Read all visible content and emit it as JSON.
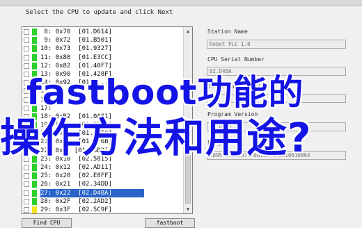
{
  "instruction": "Select the CPU to update and click Next",
  "cpu_list": [
    {
      "index": "8:",
      "addr": "0x70",
      "ver": "[01.D614]",
      "status": "green"
    },
    {
      "index": "9:",
      "addr": "0x72",
      "ver": "[01.B501]",
      "status": "green"
    },
    {
      "index": "10:",
      "addr": "0x73",
      "ver": "[01.9327]",
      "status": "green"
    },
    {
      "index": "11:",
      "addr": "0x80",
      "ver": "[01.E3CC]",
      "status": "green"
    },
    {
      "index": "12:",
      "addr": "0x82",
      "ver": "[01.40F7]",
      "status": "green"
    },
    {
      "index": "13:",
      "addr": "0x90",
      "ver": "[01.428F]",
      "status": "green"
    },
    {
      "index": "14:",
      "addr": "0x92",
      "ver": "[01.0...]",
      "status": "green"
    },
    {
      "index": "15:",
      "addr": "",
      "ver": "",
      "status": "green"
    },
    {
      "index": "16:",
      "addr": "",
      "ver": "",
      "status": "green"
    },
    {
      "index": "17:",
      "addr": "",
      "ver": "",
      "status": "green"
    },
    {
      "index": "18:",
      "addr": "0xB2",
      "ver": "[01.0A81]",
      "status": "green"
    },
    {
      "index": "19:",
      "addr": "0xC1",
      "ver": "[01.B51C]",
      "status": "green"
    },
    {
      "index": "20:",
      "addr": "0xC2",
      "ver": "[01.2A50]",
      "status": "green"
    },
    {
      "index": "21:",
      "addr": "0xD0",
      "ver": "[01.3F6B]",
      "status": "green"
    },
    {
      "index": "22:",
      "addr": "0x0",
      "ver": "[01.E8B3]",
      "status": "green"
    },
    {
      "index": "23:",
      "addr": "0x10",
      "ver": "[02.5815]",
      "status": "green"
    },
    {
      "index": "24:",
      "addr": "0x12",
      "ver": "[02.AD11]",
      "status": "green"
    },
    {
      "index": "25:",
      "addr": "0x20",
      "ver": "[02.E8FF]",
      "status": "green"
    },
    {
      "index": "26:",
      "addr": "0x21",
      "ver": "[02.34DD]",
      "status": "green"
    },
    {
      "index": "27:",
      "addr": "0x22",
      "ver": "[02.D4BA]",
      "status": "green",
      "selected": true
    },
    {
      "index": "28:",
      "addr": "0x2F",
      "ver": "[02.2AD2]",
      "status": "green"
    },
    {
      "index": "29:",
      "addr": "0x3F",
      "ver": "[02.5C9F]",
      "status": "yellow"
    },
    {
      "index": "30:",
      "addr": "0x3F",
      "ver": "[02.6B78]",
      "status": "yellow"
    }
  ],
  "details": {
    "station_name_label": "Station Name",
    "station_name_value": "Robot PLC 1.0",
    "cpu_serial_label": "CPU Serial Number",
    "cpu_serial_value": "02.D4BA",
    "bootloader_label": "BootLoader Version",
    "bootloader_value": "",
    "program_label": "Program Version",
    "program_value": "02.00.0.2",
    "fingerprint_label": "FingerPrint",
    "fingerprint_value": "0895753116071A0A16071A0A10610064"
  },
  "buttons": {
    "find_cpu": "Find CPU",
    "fastboot": "fastboot"
  },
  "overlay": {
    "line1": "fastboot功能的",
    "line2": "操作方法和用途?"
  },
  "colors": {
    "status_green": "#2bd12b",
    "status_yellow": "#f2e51e",
    "selection": "#2a63c9",
    "overlay_text": "#1414e6"
  }
}
